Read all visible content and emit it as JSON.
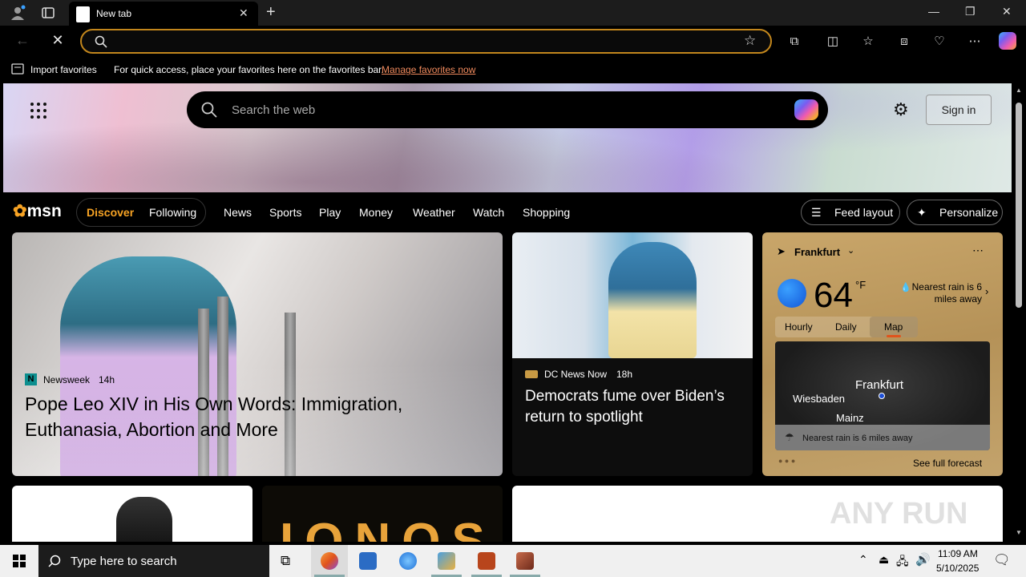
{
  "browser": {
    "tab_title": "New tab",
    "address_value": "",
    "favbar": {
      "import_label": "Import favorites",
      "hint": "For quick access, place your favorites here on the favorites bar.",
      "manage_link": "Manage favorites now"
    }
  },
  "msn": {
    "search_placeholder": "Search the web",
    "sign_in": "Sign in",
    "logo": "msn",
    "nav": {
      "discover": "Discover",
      "following": "Following",
      "items": [
        "News",
        "Sports",
        "Play",
        "Money",
        "Weather",
        "Watch",
        "Shopping"
      ],
      "feed_layout": "Feed layout",
      "personalize": "Personalize"
    },
    "cards": {
      "main": {
        "source": "Newsweek",
        "age": "14h",
        "headline": "Pope Leo XIV in His Own Words: Immigration, Euthanasia, Abortion and More"
      },
      "second": {
        "source": "DC News Now",
        "age": "18h",
        "headline": "Democrats fume over Biden’s return to spotlight"
      },
      "lower_brand": "IONOS"
    },
    "weather": {
      "city": "Frankfurt",
      "temp": "64",
      "unit": "°F",
      "nearest_rain": "Nearest rain is 6 miles away",
      "tabs": [
        "Hourly",
        "Daily",
        "Map"
      ],
      "active_tab": "Map",
      "map_labels": [
        "Frankfurt",
        "Wiesbaden",
        "Mainz"
      ],
      "map_rain_text": "Nearest rain is 6 miles away",
      "full_forecast": "See full forecast"
    },
    "watermark": "ANY RUN"
  },
  "taskbar": {
    "search_placeholder": "Type here to search",
    "time": "11:09 AM",
    "date": "5/10/2025"
  },
  "colors": {
    "accent_orange": "#f7a324",
    "omnibox_border": "#c2861c",
    "link_color": "#f08a5d"
  }
}
